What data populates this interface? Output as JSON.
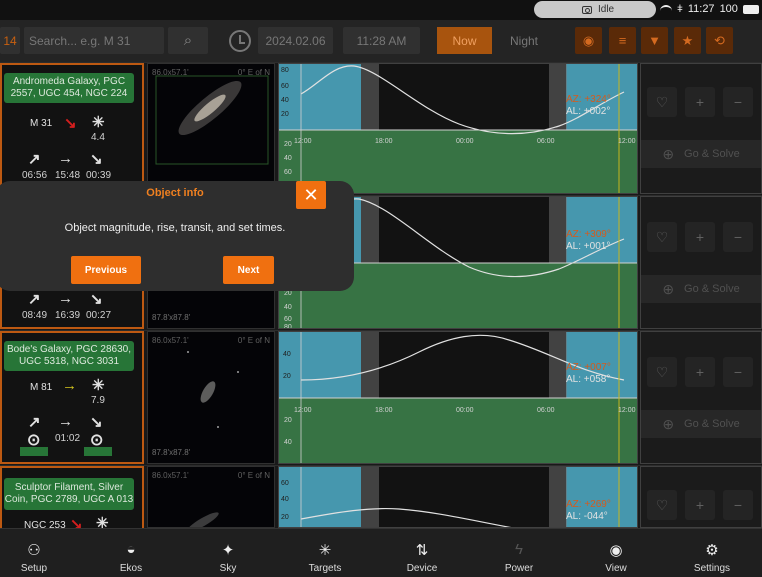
{
  "status": {
    "pill_label": "Idle",
    "time": "11:27",
    "battery": "100"
  },
  "toolbar": {
    "left_partial": "14",
    "search_placeholder": "Search... e.g. M 31",
    "date": "2024.02.06",
    "time": "11:28 AM",
    "now_label": "Now",
    "night_label": "Night",
    "icons": [
      "eye-icon",
      "list-icon",
      "filter-icon",
      "star-icon",
      "refresh-icon"
    ]
  },
  "rows": [
    {
      "name": "Andromeda Galaxy, PGC 2557, UGC 454, NGC 224",
      "id": "M 31",
      "mag": "4.4",
      "rise": "06:56",
      "transit": "15:48",
      "set": "00:39",
      "fov": "86.0x57.1'",
      "pa": "0° E of N",
      "az": "AZ: +324°",
      "al": "AL: +002°",
      "trend_color": "#e02020",
      "trend_glyph": "↘",
      "ticks_x": [
        "12:00",
        "18:00",
        "00:00",
        "06:00",
        "12:00"
      ],
      "ticks_alt": [
        "80",
        "60",
        "40",
        "20"
      ],
      "ticks_alt2": [
        "20",
        "40",
        "60",
        "80"
      ]
    },
    {
      "name": "",
      "id": "",
      "mag": "",
      "rise": "08:49",
      "transit": "16:39",
      "set": "00:27",
      "fov": "",
      "pa": "",
      "fov2": "87.8'x87.8'",
      "az": "AZ: +309°",
      "al": "AL: +001°",
      "ticks_x": [
        "12:00",
        "18:00",
        "00:00",
        "06:00",
        "12:00"
      ],
      "ticks_alt": [
        "80",
        "60",
        "40",
        "20"
      ],
      "ticks_alt2": [
        "20",
        "40",
        "60",
        "80"
      ]
    },
    {
      "name": "Bode's Galaxy, PGC 28630, UGC 5318, NGC 3031",
      "id": "M 81",
      "mag": "7.9",
      "transit": "01:02",
      "fov": "86.0x57.1'",
      "pa": "0° E of N",
      "fov2": "87.8'x87.8'",
      "az": "AZ: +007°",
      "al": "AL: +058°",
      "trend_color": "#e0d020",
      "trend_glyph": "→",
      "ticks_x": [
        "12:00",
        "18:00",
        "00:00",
        "06:00",
        "12:00"
      ],
      "ticks_alt": [
        "40",
        "20"
      ],
      "ticks_alt2": [
        "20",
        "40"
      ]
    },
    {
      "name": "Sculptor Filament, Silver Coin, PGC 2789, UGC A 013",
      "id": "NGC 253",
      "fov": "86.0x57.1'",
      "pa": "0° E of N",
      "az": "AZ: +269°",
      "al": "AL: -044°",
      "trend_color": "#e02020",
      "trend_glyph": "↘",
      "ticks_alt": [
        "60",
        "40",
        "20"
      ]
    }
  ],
  "actions": {
    "goto_label": "Go & Solve",
    "plus": "+",
    "minus": "−",
    "heart": "♡"
  },
  "dialog": {
    "title": "Object info",
    "text": "Object magnitude, rise, transit, and set times.",
    "prev": "Previous",
    "next": "Next",
    "close": "✕"
  },
  "nav": [
    {
      "label": "Setup",
      "icon": "setup-icon"
    },
    {
      "label": "Ekos",
      "icon": "ekos-icon"
    },
    {
      "label": "Sky",
      "icon": "sky-icon"
    },
    {
      "label": "Targets",
      "icon": "targets-icon"
    },
    {
      "label": "Device",
      "icon": "device-icon"
    },
    {
      "label": "Power",
      "icon": "power-icon"
    },
    {
      "label": "View",
      "icon": "view-icon"
    },
    {
      "label": "Settings",
      "icon": "settings-icon"
    }
  ]
}
